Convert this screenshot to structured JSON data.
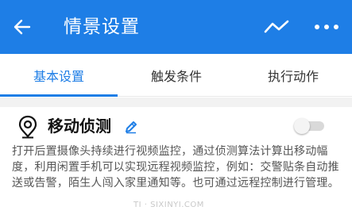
{
  "app_bar": {
    "title": "情景设置",
    "background_color": "#1e7ee6",
    "icons": [
      "back-arrow-icon",
      "trend-icon",
      "more-icon"
    ]
  },
  "tabs": [
    {
      "label": "基本设置",
      "active": true
    },
    {
      "label": "触发条件",
      "active": false
    },
    {
      "label": "执行动作",
      "active": false
    }
  ],
  "feature": {
    "icon": "location-pin-icon",
    "title": "移动侦测",
    "edit_icon": "pencil-icon",
    "enabled": false,
    "description": "打开后置摄像头持续进行视频监控，通过侦测算法计算出移动幅度，利用闲置手机可以实现远程视频监控，例如：交警贴条自动推送或告警，陌生人闯入家里通知等。也可通过远程控制进行管理。"
  },
  "watermark": "TI · SIXINYI.COM"
}
